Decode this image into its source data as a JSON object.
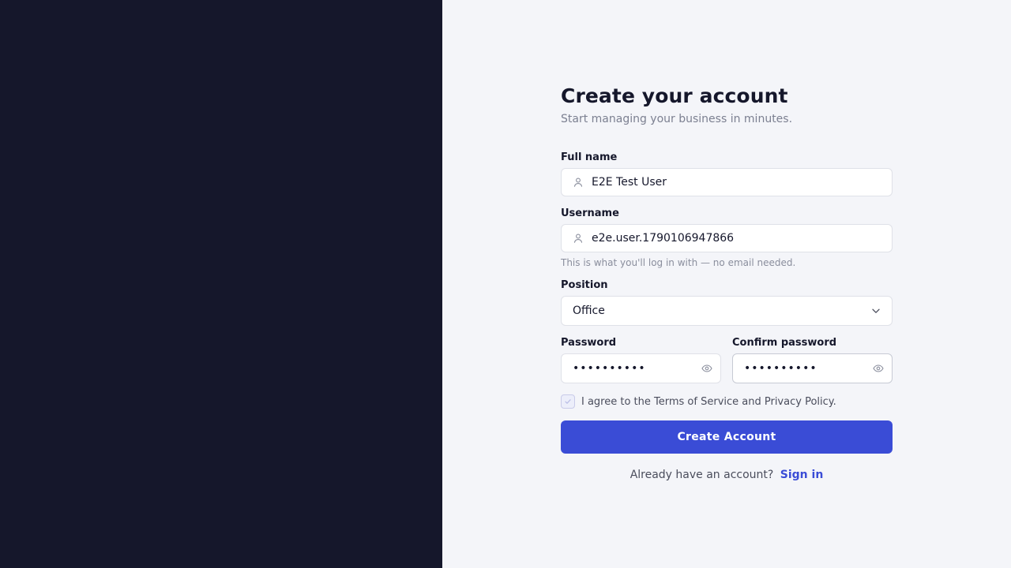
{
  "form": {
    "title": "Create your account",
    "subtitle": "Start managing your business in minutes.",
    "full_name": {
      "label": "Full name",
      "value": "E2E Test User",
      "icon": "user-icon"
    },
    "username": {
      "label": "Username",
      "value": "e2e.user.1790106947866",
      "icon": "user-icon",
      "hint": "This is what you'll log in with — no email needed."
    },
    "position": {
      "label": "Position",
      "selected": "Office",
      "icon": "chevron-down-icon"
    },
    "password": {
      "label": "Password",
      "masked": "••••••••••",
      "icon": "eye-icon"
    },
    "confirm_password": {
      "label": "Confirm password",
      "masked": "••••••••••",
      "icon": "eye-icon"
    },
    "agree": {
      "text": "I agree to the Terms of Service and Privacy Policy.",
      "checked": true
    },
    "submit_label": "Create Account",
    "signin_prompt": "Already have an account?",
    "signin_link": "Sign in"
  },
  "colors": {
    "left_panel": "#15172b",
    "background": "#f4f5f9",
    "accent": "#3a4cd6",
    "text_primary": "#15172b",
    "text_muted": "#7c8091"
  }
}
